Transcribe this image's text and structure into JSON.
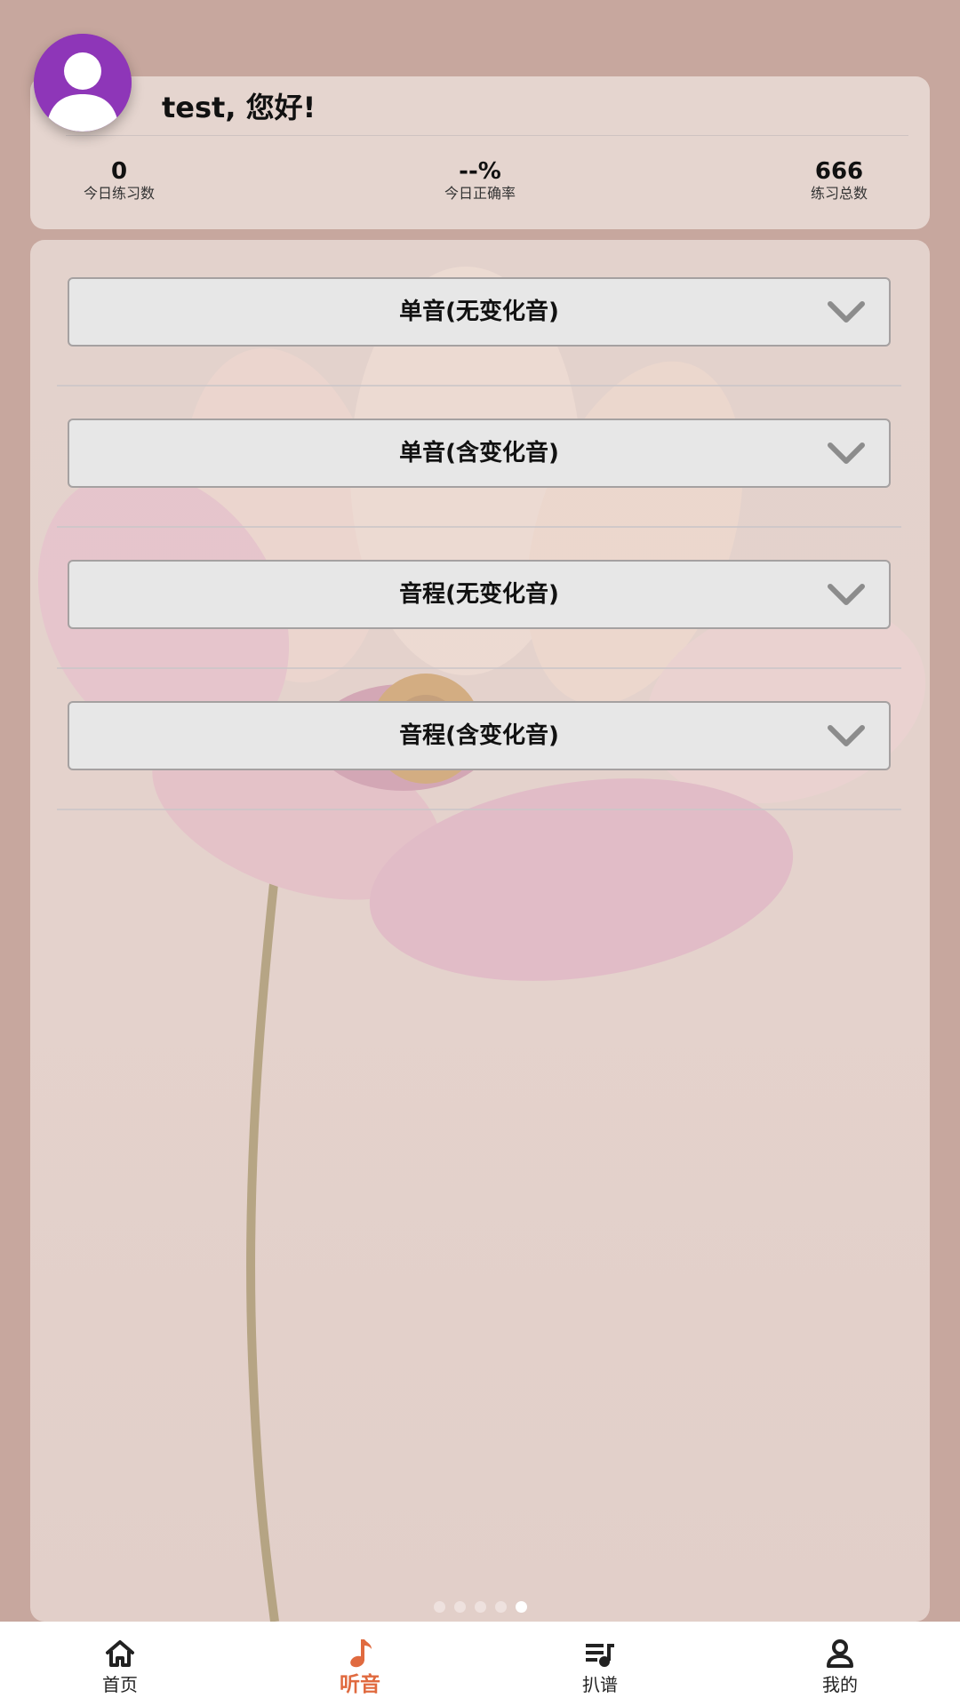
{
  "header": {
    "greeting": "test, 您好!",
    "avatar_icon": "user-avatar-icon",
    "avatar_color": "#8e36b8",
    "stats": [
      {
        "value": "0",
        "label": "今日练习数"
      },
      {
        "value": "--%",
        "label": "今日正确率"
      },
      {
        "value": "666",
        "label": "练习总数"
      }
    ]
  },
  "main": {
    "dropdowns": [
      {
        "label": "单音(无变化音)",
        "icon": "chevron-down-icon"
      },
      {
        "label": "单音(含变化音)",
        "icon": "chevron-down-icon"
      },
      {
        "label": "音程(无变化音)",
        "icon": "chevron-down-icon"
      },
      {
        "label": "音程(含变化音)",
        "icon": "chevron-down-icon"
      }
    ],
    "pager": {
      "count": 5,
      "active_index": 4
    }
  },
  "nav": {
    "accent_color": "#e06a3f",
    "items": [
      {
        "label": "首页",
        "icon": "home-icon",
        "active": false
      },
      {
        "label": "听音",
        "icon": "music-note-icon",
        "active": true
      },
      {
        "label": "扒谱",
        "icon": "playlist-music-icon",
        "active": false
      },
      {
        "label": "我的",
        "icon": "person-icon",
        "active": false
      }
    ]
  }
}
